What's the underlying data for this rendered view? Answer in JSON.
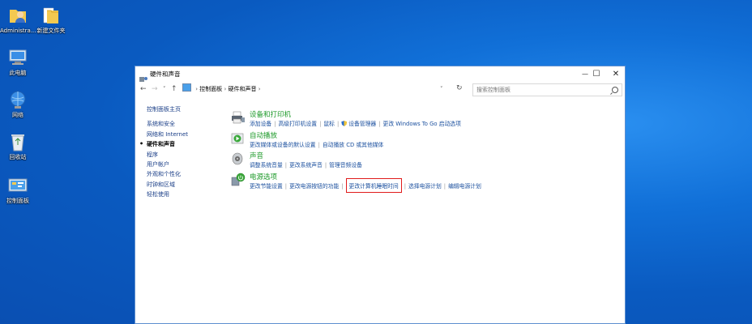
{
  "desktop": {
    "icons": [
      {
        "label": "Administra...",
        "icon": "user-folder-icon"
      },
      {
        "label": "新建文件夹",
        "icon": "folder-icon"
      },
      {
        "label": "此电脑",
        "icon": "computer-icon"
      },
      {
        "label": "网络",
        "icon": "network-icon"
      },
      {
        "label": "回收站",
        "icon": "recycle-bin-icon"
      },
      {
        "label": "控制面板",
        "icon": "control-panel-icon"
      }
    ]
  },
  "window": {
    "title": "硬件和声音",
    "controls": {
      "minimize": "—",
      "maximize": "☐",
      "close": "✕"
    },
    "nav": {
      "back": "←",
      "forward": "→",
      "recent": "˅",
      "up": "↑"
    },
    "breadcrumb": [
      "控制面板",
      "硬件和声音"
    ],
    "search_placeholder": "搜索控制面板"
  },
  "left_nav": {
    "home": "控制面板主页",
    "items": [
      "系统和安全",
      "网络和 Internet",
      "硬件和声音",
      "程序",
      "用户帐户",
      "外观和个性化",
      "时钟和区域",
      "轻松使用"
    ],
    "current": "硬件和声音"
  },
  "categories": [
    {
      "title": "设备和打印机",
      "icon": "printer-icon",
      "links": [
        "添加设备",
        "高级打印机设置",
        "鼠标",
        "设备管理器",
        "更改 Windows To Go 启动选项"
      ]
    },
    {
      "title": "自动播放",
      "icon": "autoplay-icon",
      "links": [
        "更改媒体或设备的默认设置",
        "自动播放 CD 或其他媒体"
      ]
    },
    {
      "title": "声音",
      "icon": "speaker-icon",
      "links": [
        "调整系统音量",
        "更改系统声音",
        "管理音频设备"
      ]
    },
    {
      "title": "电源选项",
      "icon": "power-icon",
      "links": [
        "更改节能设置",
        "更改电源按钮的功能",
        "更改计算机睡眠时间",
        "选择电源计划",
        "编辑电源计划"
      ]
    }
  ],
  "highlighted_link": "更改计算机睡眠时间",
  "colors": {
    "highlight": "#e01b1b",
    "link": "#1a4f9e",
    "category_title": "#1e9a2a"
  }
}
